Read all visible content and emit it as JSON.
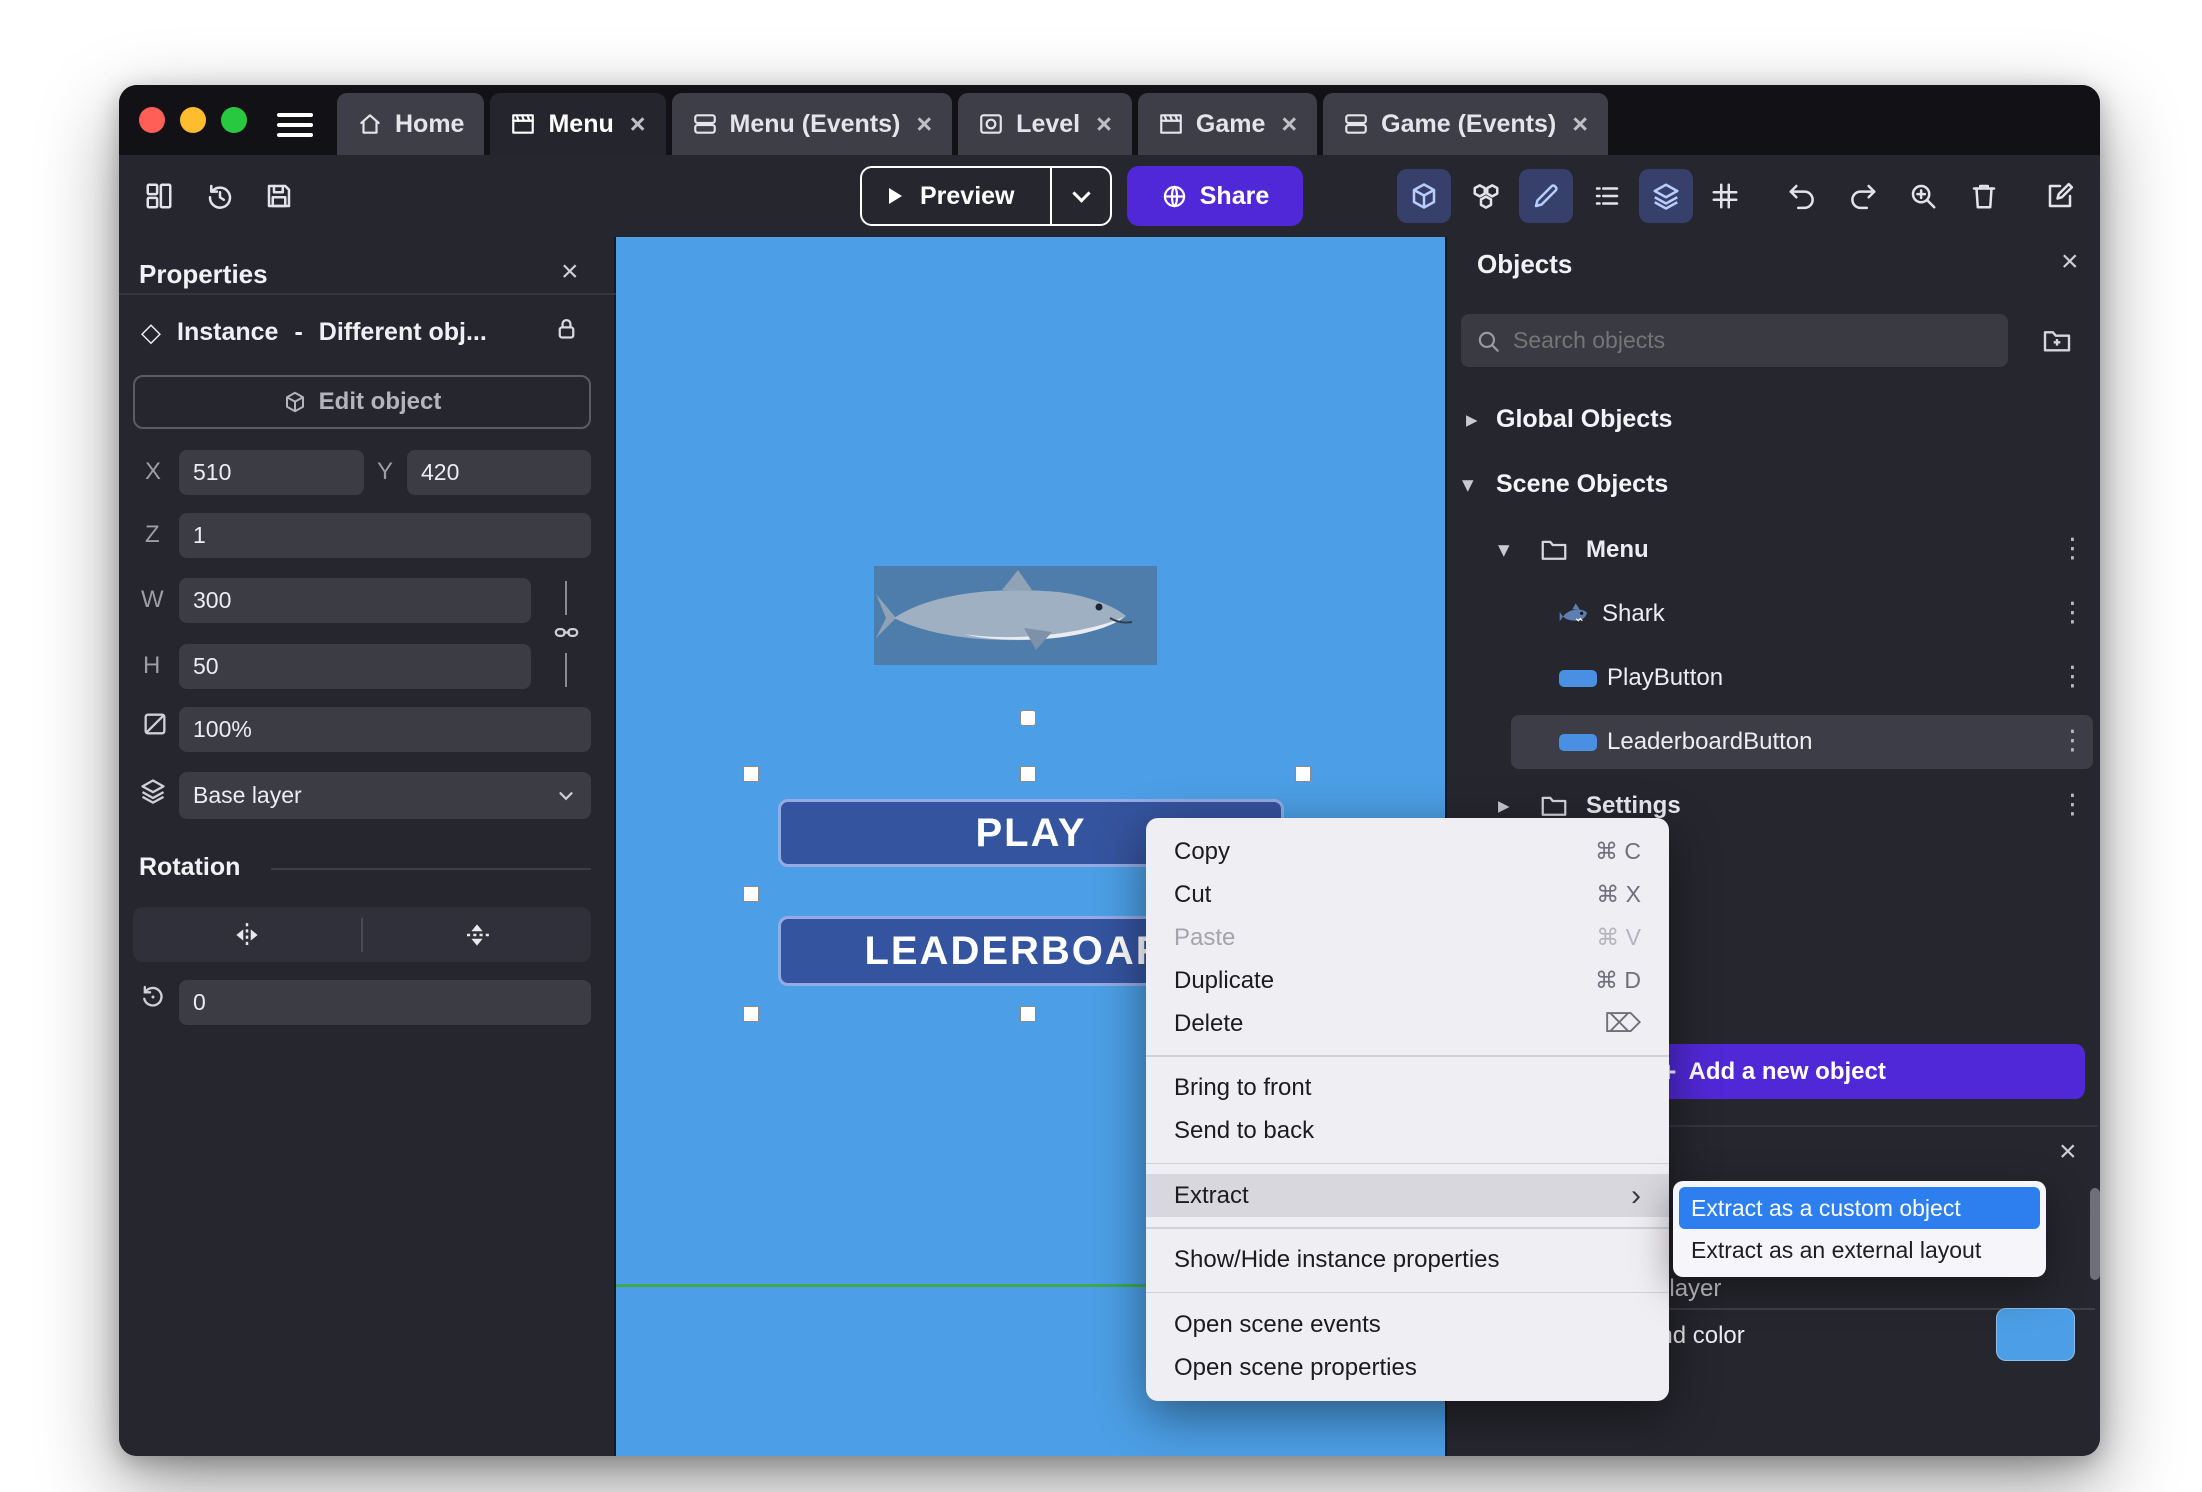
{
  "glyphs": {
    "close": "×",
    "kebab": "⋮",
    "submenu_arrow": "›",
    "expanded": "▾",
    "collapsed": "▸",
    "plus": "+"
  },
  "titlebar": {
    "tabs": [
      {
        "label": "Home"
      },
      {
        "label": "Menu"
      },
      {
        "label": "Menu (Events)"
      },
      {
        "label": "Level"
      },
      {
        "label": "Game"
      },
      {
        "label": "Game (Events)"
      }
    ]
  },
  "toolbar": {
    "preview": "Preview",
    "share": "Share"
  },
  "properties_panel": {
    "title": "Properties",
    "instance": {
      "label": "Instance",
      "separator": "-",
      "value": "Different obj..."
    },
    "edit_object_label": "Edit object",
    "x_label": "X",
    "x_value": "510",
    "y_label": "Y",
    "y_value": "420",
    "z_label": "Z",
    "z_value": "1",
    "w_label": "W",
    "w_value": "300",
    "h_label": "H",
    "h_value": "50",
    "opacity_value": "100%",
    "layer_value": "Base layer",
    "rotation_title": "Rotation",
    "rotation_value": "0"
  },
  "scene": {
    "play": "PLAY",
    "leaderboard": "LEADERBOARD"
  },
  "objects_panel": {
    "title": "Objects",
    "search_placeholder": "Search objects",
    "global_objects_label": "Global Objects",
    "scene_objects_label": "Scene Objects",
    "menu_folder_label": "Menu",
    "settings_folder_label": "Settings",
    "shark_label": "Shark",
    "play_button_label": "PlayButton",
    "leaderboard_button_label": "LeaderboardButton",
    "add_button_label": "Add a new object"
  },
  "layers_panel": {
    "layer_row_text": "Base layer",
    "background_color_label": "Background color"
  },
  "context_menu": {
    "copy": {
      "label": "Copy",
      "shortcut": "⌘ C"
    },
    "cut": {
      "label": "Cut",
      "shortcut": "⌘ X"
    },
    "paste": {
      "label": "Paste",
      "shortcut": "⌘ V"
    },
    "duplicate": {
      "label": "Duplicate",
      "shortcut": "⌘ D"
    },
    "delete": {
      "label": "Delete",
      "shortcut": "⌦"
    },
    "bring_to_front": {
      "label": "Bring to front"
    },
    "send_to_back": {
      "label": "Send to back"
    },
    "extract": {
      "label": "Extract"
    },
    "show_hide": {
      "label": "Show/Hide instance properties"
    },
    "open_scene_events": {
      "label": "Open scene events"
    },
    "open_scene_properties": {
      "label": "Open scene properties"
    }
  },
  "extract_submenu": {
    "custom_object": "Extract as a custom object",
    "external_layout": "Extract as an external layout"
  },
  "colors": {
    "accent": "#5128d7",
    "canvas_blue": "#4c9fe6",
    "submenu_highlight": "#2d7ff0",
    "background_swatch": "#4c9fe6"
  }
}
